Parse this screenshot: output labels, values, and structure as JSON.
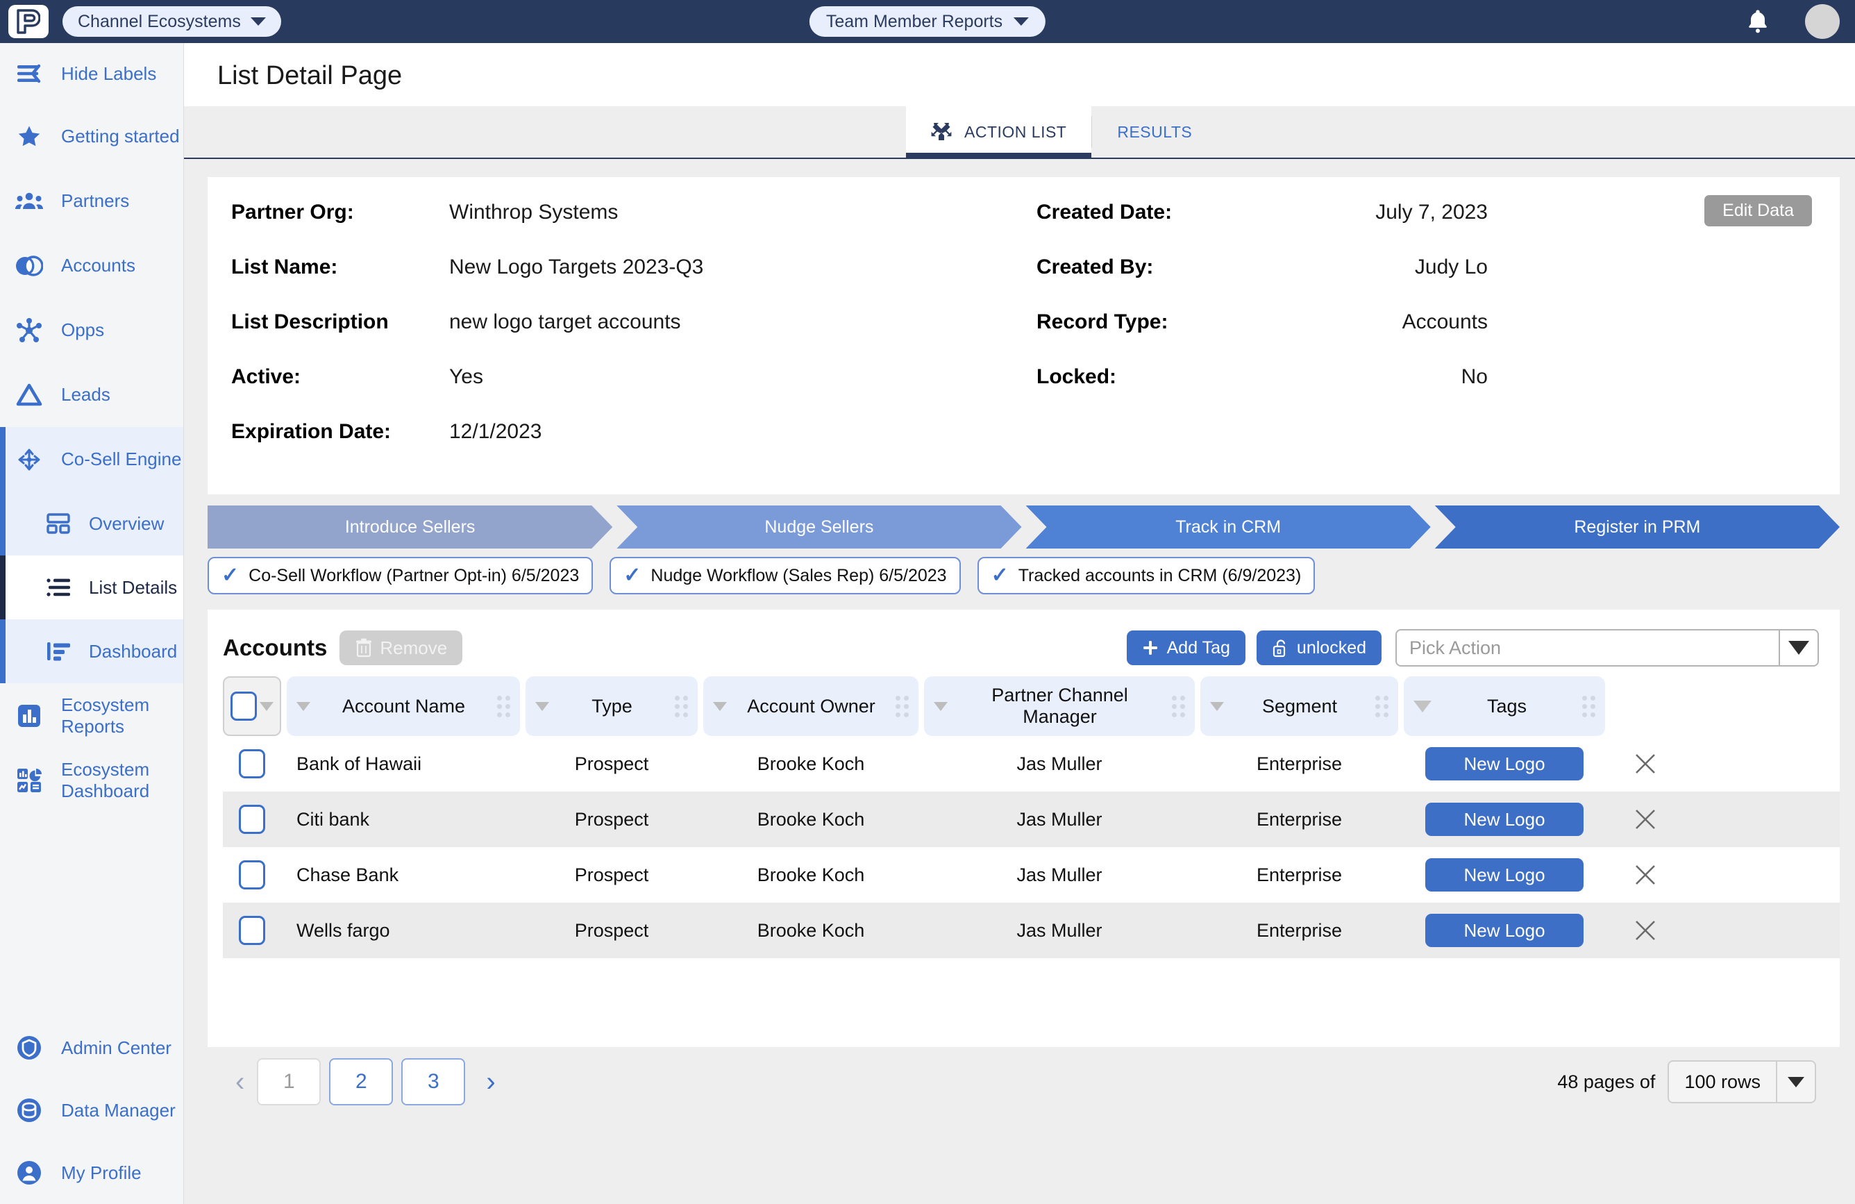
{
  "colors": {
    "topbar": "#283a5e",
    "accent_blue": "#3b6fc9",
    "tag_blue": "#3d6fc6",
    "sidebar_bg": "#f4f5f7"
  },
  "topbar": {
    "logo_name": "prm-logo",
    "org_selector": "Channel Ecosystems",
    "center_selector": "Team Member Reports",
    "notifications_icon": "bell-icon",
    "avatar_label": "avatar"
  },
  "sidebar": {
    "toggle_label": "Hide Labels",
    "items": [
      {
        "label": "Getting started",
        "icon": "star-icon"
      },
      {
        "label": "Partners",
        "icon": "people-group-icon"
      },
      {
        "label": "Accounts",
        "icon": "venn-circles-icon"
      },
      {
        "label": "Opps",
        "icon": "network-nodes-icon"
      },
      {
        "label": "Leads",
        "icon": "triangle-icon"
      }
    ],
    "group": {
      "label": "Co-Sell Engine",
      "icon": "move-arrows-icon",
      "children": [
        {
          "label": "Overview",
          "icon": "layout-grid-icon",
          "active": false
        },
        {
          "label": "List Details",
          "icon": "list-icon",
          "active": true
        },
        {
          "label": "Dashboard",
          "icon": "bar-chart-horizontal-icon",
          "active": false
        }
      ]
    },
    "items_after": [
      {
        "label": "Ecosystem Reports",
        "icon": "report-chart-icon"
      },
      {
        "label": "Ecosystem Dashboard",
        "icon": "dashboard-icon"
      }
    ],
    "bottom_items": [
      {
        "label": "Admin Center",
        "icon": "shield-icon"
      },
      {
        "label": "Data Manager",
        "icon": "database-icon"
      },
      {
        "label": "My Profile",
        "icon": "user-icon"
      }
    ]
  },
  "page": {
    "title": "List Detail Page"
  },
  "tabs": [
    {
      "label": "ACTION LIST",
      "icon": "crossed-arrows-icon",
      "active": true
    },
    {
      "label": "RESULTS",
      "active": false
    }
  ],
  "detail": {
    "edit_button": "Edit Data",
    "left": [
      {
        "label": "Partner Org:",
        "value": "Winthrop Systems"
      },
      {
        "label": "List Name:",
        "value": "New Logo Targets 2023-Q3"
      },
      {
        "label": "List Description",
        "value": "new logo target accounts"
      },
      {
        "label": "Active:",
        "value": "Yes"
      },
      {
        "label": "Expiration Date:",
        "value": "12/1/2023"
      }
    ],
    "right": [
      {
        "label": "Created Date:",
        "value": "July 7, 2023"
      },
      {
        "label": "Created By:",
        "value": "Judy Lo"
      },
      {
        "label": "Record Type:",
        "value": "Accounts"
      },
      {
        "label": "Locked:",
        "value": "No"
      }
    ]
  },
  "steps": [
    {
      "label": "Introduce Sellers"
    },
    {
      "label": "Nudge Sellers"
    },
    {
      "label": "Track in CRM"
    },
    {
      "label": "Register in PRM"
    }
  ],
  "chips": [
    {
      "label": "Co-Sell Workflow (Partner Opt-in) 6/5/2023",
      "checked": true
    },
    {
      "label": "Nudge Workflow (Sales Rep) 6/5/2023",
      "checked": true
    },
    {
      "label": "Tracked accounts in CRM  (6/9/2023)",
      "checked": true
    }
  ],
  "table_toolbar": {
    "title": "Accounts",
    "remove_label": "Remove",
    "remove_icon": "trash-icon",
    "add_tag_label": "Add Tag",
    "add_tag_icon": "plus-icon",
    "lock_label": "unlocked",
    "lock_icon": "unlock-icon",
    "pick_action_placeholder": "Pick Action",
    "pick_action_value": ""
  },
  "table": {
    "columns": [
      "Account Name",
      "Type",
      "Account Owner",
      "Partner Channel Manager",
      "Segment",
      "Tags"
    ],
    "rows": [
      {
        "name": "Bank of Hawaii",
        "type": "Prospect",
        "owner": "Brooke Koch",
        "pcm": "Jas Muller",
        "segment": "Enterprise",
        "tag": "New Logo"
      },
      {
        "name": "Citi bank",
        "type": "Prospect",
        "owner": "Brooke Koch",
        "pcm": "Jas Muller",
        "segment": "Enterprise",
        "tag": "New Logo"
      },
      {
        "name": "Chase Bank",
        "type": "Prospect",
        "owner": "Brooke Koch",
        "pcm": "Jas Muller",
        "segment": "Enterprise",
        "tag": "New Logo"
      },
      {
        "name": "Wells fargo",
        "type": "Prospect",
        "owner": "Brooke Koch",
        "pcm": "Jas Muller",
        "segment": "Enterprise",
        "tag": "New Logo"
      }
    ]
  },
  "pagination": {
    "prev_icon": "chevron-left-icon",
    "next_icon": "chevron-right-icon",
    "pages": [
      "1",
      "2",
      "3"
    ],
    "current_page": "1",
    "pages_of_label": "48 pages of",
    "rows_per_page": "100 rows"
  }
}
